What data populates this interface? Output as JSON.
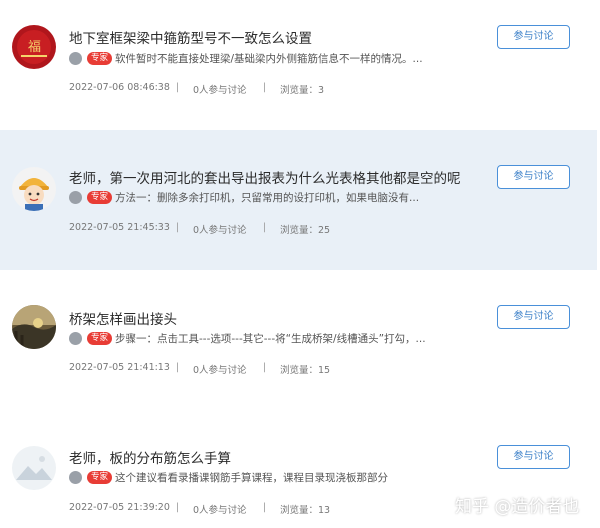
{
  "questions": [
    {
      "title": "地下室框架梁中箍筋型号不一致怎么设置",
      "badge": "专家",
      "answer": "软件暂时不能直接处理梁/基础梁内外侧箍筋信息不一样的情况。...",
      "date": "2022-07-06 08:46:38",
      "participants": "0人参与讨论",
      "views": "浏览量：3",
      "button": "参与讨论",
      "avatar_text": "福"
    },
    {
      "title": "老师，第一次用河北的套出导出报表为什么光表格其他都是空的呢",
      "badge": "专家",
      "answer": "方法一：删除多余打印机，只留常用的设打印机，如果电脑没有...",
      "date": "2022-07-05 21:45:33",
      "participants": "0人参与讨论",
      "views": "浏览量：25",
      "button": "参与讨论"
    },
    {
      "title": "桥架怎样画出接头",
      "badge": "专家",
      "answer": "步骤一：点击工具---选项---其它---将“生成桥架/线槽通头”打勾，...",
      "date": "2022-07-05 21:41:13",
      "participants": "0人参与讨论",
      "views": "浏览量：15",
      "button": "参与讨论"
    },
    {
      "title": "老师，板的分布筋怎么手算",
      "badge": "专家",
      "answer": "这个建议看看录播课钢筋手算课程，课程目录现浇板那部分",
      "date": "2022-07-05 21:39:20",
      "participants": "0人参与讨论",
      "views": "浏览量：13",
      "button": "参与讨论"
    }
  ],
  "watermark": "知乎 @造价者也",
  "colors": {
    "highlight_bg": "#e9f0f7",
    "badge": "#e83c35",
    "button_border": "#4a90d9"
  }
}
